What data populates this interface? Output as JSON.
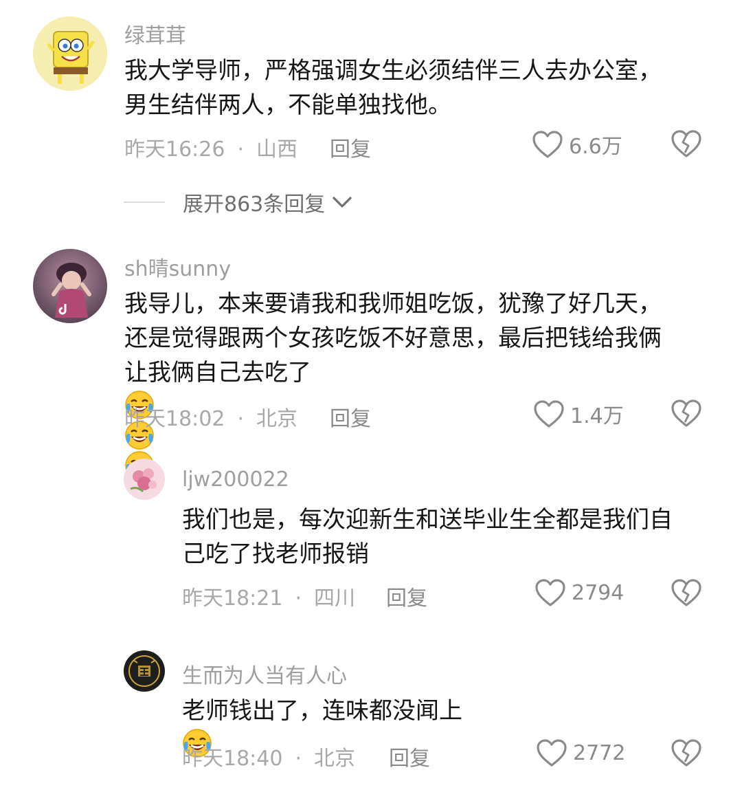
{
  "comments": [
    {
      "username": "绿茸茸",
      "lines": [
        "我大学导师，严格强调女生必须结伴三人去办公室，",
        "男生结伴两人，不能单独找他。"
      ],
      "time": "昨天16:26",
      "dot": "·",
      "location": "山西",
      "reply": "回复",
      "likes": "6.6万",
      "avatar_icon": "spongebob-avatar"
    },
    {
      "username": "sh晴sunny",
      "lines": [
        "我导儿，本来要请我和我师姐吃饭，犹豫了好几天，",
        "还是觉得跟两个女孩吃饭不好意思，最后把钱给我俩",
        "让我俩自己去吃了"
      ],
      "emoji": "laughing-crying-emoji",
      "time": "昨天18:02",
      "dot": "·",
      "location": "北京",
      "reply": "回复",
      "likes": "1.4万",
      "avatar_icon": "girl-photo-avatar"
    },
    {
      "username": "ljw200022",
      "lines": [
        "我们也是，每次迎新生和送毕业生全都是我们自",
        "己吃了找老师报销"
      ],
      "time": "昨天18:21",
      "dot": "·",
      "location": "四川",
      "reply": "回复",
      "likes": "2794",
      "avatar_icon": "flower-avatar"
    },
    {
      "username": "生而为人当有人心",
      "lines": [
        "老师钱出了，连味都没闻上"
      ],
      "emoji": "laughing-crying-emoji",
      "time": "昨天18:40",
      "dot": "·",
      "location": "北京",
      "reply": "回复",
      "likes": "2772",
      "avatar_icon": "gold-seal-avatar"
    }
  ],
  "expand_replies": "展开863条回复",
  "colors": {
    "text": "#161616",
    "meta": "#a8a8a8",
    "username": "#9e9e9e"
  }
}
